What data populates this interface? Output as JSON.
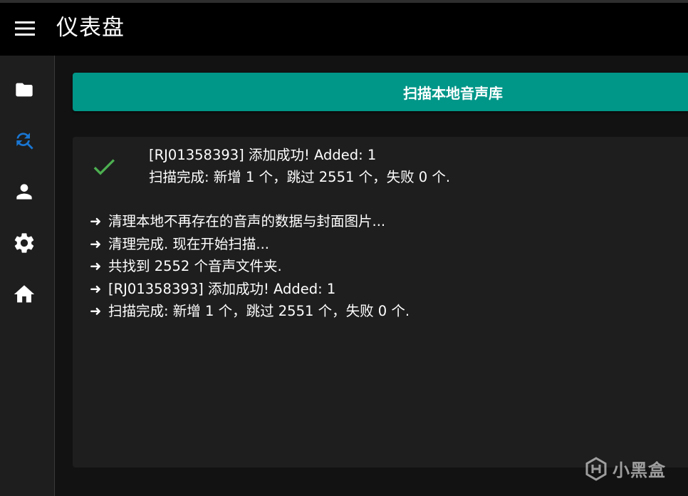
{
  "app": {
    "title": "仪表盘"
  },
  "sidebar": {
    "items": [
      {
        "icon": "folder-icon",
        "active": false
      },
      {
        "icon": "search-refresh-icon",
        "active": true
      },
      {
        "icon": "person-icon",
        "active": false
      },
      {
        "icon": "gear-icon",
        "active": false
      },
      {
        "icon": "home-icon",
        "active": false
      }
    ]
  },
  "main": {
    "scan_button_label": "扫描本地音声库",
    "status": {
      "icon": "checkmark-icon",
      "line1": "[RJ01358393] 添加成功! Added: 1",
      "line2": "扫描完成: 新增 1 个，跳过 2551 个，失败 0 个."
    },
    "log": {
      "arrow": "➜",
      "lines": [
        "清理本地不再存在的音声的数据与封面图片...",
        "清理完成. 现在开始扫描...",
        "共找到 2552 个音声文件夹.",
        "[RJ01358393] 添加成功! Added: 1",
        "扫描完成: 新增 1 个，跳过 2551 个，失败 0 个."
      ]
    }
  },
  "watermark": {
    "text": "小黑盒"
  },
  "colors": {
    "accent": "#009688",
    "active_nav": "#1976d2",
    "success": "#4caf50",
    "topbar": "#000000",
    "sidebar": "#1e1e1e",
    "card": "#1e1e1e",
    "background": "#121212"
  }
}
